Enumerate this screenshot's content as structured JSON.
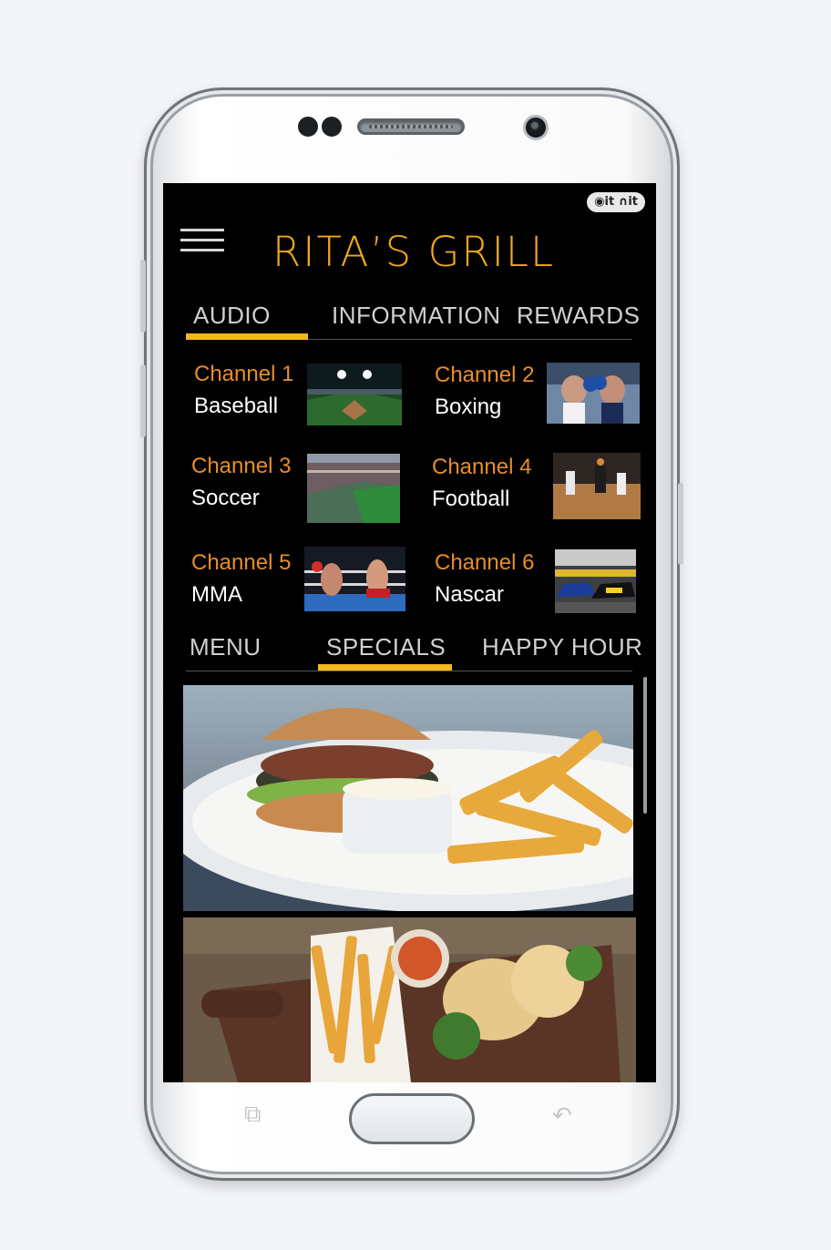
{
  "app": {
    "watermark": "◉it ∩it",
    "brand_title": "RITA’S GRILL"
  },
  "top_tabs": [
    {
      "label": "AUDIO",
      "active": true
    },
    {
      "label": "INFORMATION",
      "active": false
    },
    {
      "label": "REWARDS",
      "active": false
    }
  ],
  "channels": [
    {
      "name": "Channel 1",
      "sport": "Baseball"
    },
    {
      "name": "Channel 2",
      "sport": "Boxing"
    },
    {
      "name": "Channel 3",
      "sport": "Soccer"
    },
    {
      "name": "Channel 4",
      "sport": "Football"
    },
    {
      "name": "Channel 5",
      "sport": "MMA"
    },
    {
      "name": "Channel 6",
      "sport": "Nascar"
    }
  ],
  "food_tabs": [
    {
      "label": "MENU",
      "active": false
    },
    {
      "label": "SPECIALS",
      "active": true
    },
    {
      "label": "HAPPY HOUR",
      "active": false
    }
  ],
  "colors": {
    "accent": "#f4b81c",
    "channel_name": "#e88d2a",
    "brand": "#f2a81d",
    "screen_bg": "#000000"
  },
  "soft_keys": {
    "recent": "⧉",
    "back": "↶"
  }
}
